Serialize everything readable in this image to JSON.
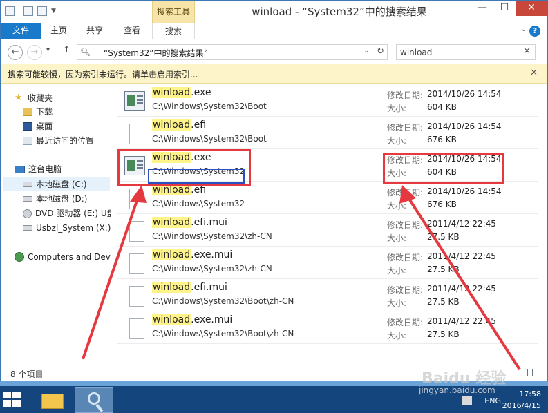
{
  "window": {
    "title": "winload - “System32”中的搜索结果",
    "context_tab_header": "搜索工具",
    "controls": {
      "minimize": "—",
      "maximize": "☐",
      "close": "✕"
    }
  },
  "ribbon": {
    "tabs": [
      "文件",
      "主页",
      "共享",
      "查看",
      "搜索"
    ],
    "expand_glyph": "⌄",
    "help_glyph": "?"
  },
  "address": {
    "path": "“System32”中的搜索结果",
    "chevron": "›",
    "dropdown_glyph": "⌄",
    "refresh_glyph": "↻",
    "search_value": "winload",
    "search_clear": "✕"
  },
  "infobar": {
    "message": "搜索可能较慢，因为索引未运行。请单击启用索引...",
    "close": "✕"
  },
  "navpane": {
    "favorites": {
      "label": "收藏夹",
      "items": [
        "下载",
        "桌面",
        "最近访问的位置"
      ]
    },
    "thispc": {
      "label": "这台电脑",
      "items": [
        "本地磁盘 (C:)",
        "本地磁盘 (D:)",
        "DVD 驱动器 (E:) U盘",
        "Usbzl_System (X:)"
      ]
    },
    "network": "Computers and Devices"
  },
  "results": {
    "modified_label": "修改日期:",
    "size_label": "大小:",
    "items": [
      {
        "match": "winload",
        "ext": ".exe",
        "path": "C:\\Windows\\System32\\Boot",
        "modified": "2014/10/26 14:54",
        "size": "604 KB",
        "icon": "exe-icon"
      },
      {
        "match": "winload",
        "ext": ".efi",
        "path": "C:\\Windows\\System32\\Boot",
        "modified": "2014/10/26 14:54",
        "size": "676 KB",
        "icon": "file-icon"
      },
      {
        "match": "winload",
        "ext": ".exe",
        "path": "C:\\Windows\\System32",
        "modified": "2014/10/26 14:54",
        "size": "604 KB",
        "icon": "exe-icon"
      },
      {
        "match": "winload",
        "ext": ".efi",
        "path": "C:\\Windows\\System32",
        "modified": "2014/10/26 14:54",
        "size": "676 KB",
        "icon": "file-icon"
      },
      {
        "match": "winload",
        "ext": ".efi.mui",
        "path": "C:\\Windows\\System32\\zh-CN",
        "modified": "2011/4/12 22:45",
        "size": "27.5 KB",
        "icon": "file-icon"
      },
      {
        "match": "winload",
        "ext": ".exe.mui",
        "path": "C:\\Windows\\System32\\zh-CN",
        "modified": "2011/4/12 22:45",
        "size": "27.5 KB",
        "icon": "file-icon"
      },
      {
        "match": "winload",
        "ext": ".efi.mui",
        "path": "C:\\Windows\\System32\\Boot\\zh-CN",
        "modified": "2011/4/12 22:45",
        "size": "27.5 KB",
        "icon": "file-icon"
      },
      {
        "match": "winload",
        "ext": ".exe.mui",
        "path": "C:\\Windows\\System32\\Boot\\zh-CN",
        "modified": "2011/4/12 22:45",
        "size": "27.5 KB",
        "icon": "file-icon"
      }
    ]
  },
  "statusbar": {
    "count": "8 个项目"
  },
  "taskbar": {
    "lang": "ENG",
    "time": "17:58",
    "date": "2016/4/15"
  },
  "watermark": {
    "main": "Baidu 经验",
    "sub": "jingyan.baidu.com"
  },
  "colors": {
    "highlight": "#fff48a",
    "annotation_red": "#e5393f",
    "annotation_blue": "#2c4fbf",
    "accent": "#1979ca"
  }
}
